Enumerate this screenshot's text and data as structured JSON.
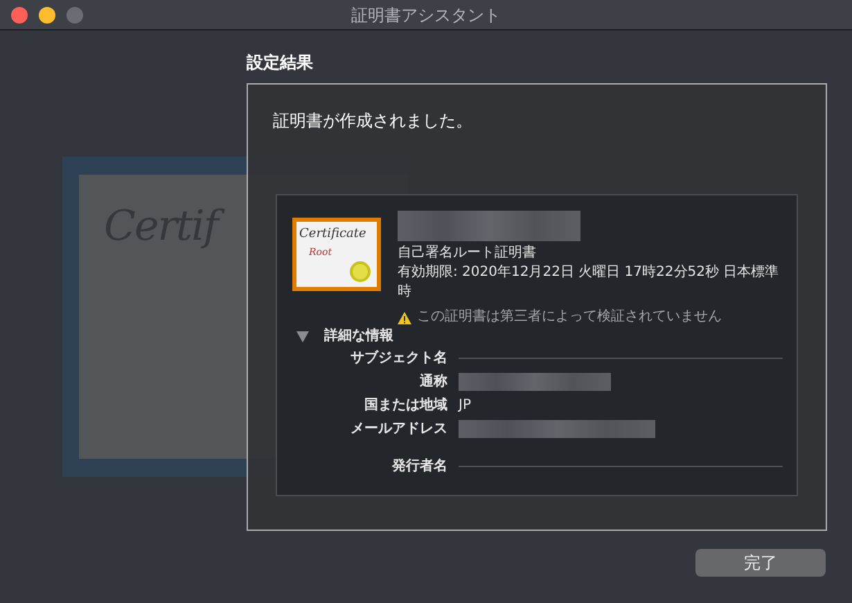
{
  "window": {
    "title": "証明書アシスタント"
  },
  "backdrop": {
    "text": "Certif"
  },
  "heading": "設定結果",
  "message": "証明書が作成されました。",
  "certificate": {
    "thumbnail_title": "Certificate",
    "thumbnail_subtitle": "Root",
    "type": "自己署名ルート証明書",
    "expiry": "有効期限: 2020年12月22日 火曜日 17時22分52秒 日本標準時",
    "warning": "この証明書は第三者によって検証されていません",
    "details": {
      "label": "詳細な情報",
      "expanded": true,
      "rows": [
        {
          "kind": "section",
          "label": "サブジェクト名"
        },
        {
          "kind": "redacted",
          "label": "通称"
        },
        {
          "kind": "value",
          "label": "国または地域",
          "value": "JP"
        },
        {
          "kind": "redacted",
          "label": "メールアドレス"
        },
        {
          "kind": "section",
          "label": "発行者名"
        }
      ]
    }
  },
  "buttons": [
    {
      "label": "完了"
    }
  ]
}
